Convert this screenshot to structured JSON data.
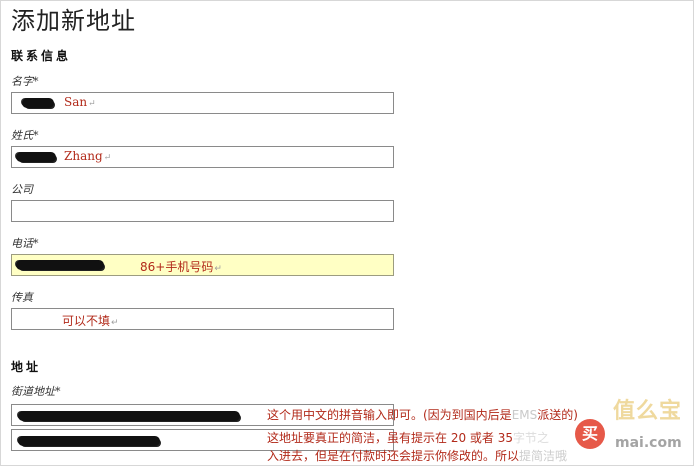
{
  "page": {
    "title": "添加新地址"
  },
  "contact_section": {
    "title": "联系信息",
    "fields": [
      {
        "label": "名字*",
        "note": "San",
        "return_mark": "↵"
      },
      {
        "label": "姓氏*",
        "note": "Zhang",
        "return_mark": "↵"
      },
      {
        "label": "公司",
        "note": ""
      },
      {
        "label": "电话*",
        "note": "86+手机号码",
        "return_mark": "↵"
      },
      {
        "label": "传真",
        "note": "可以不填",
        "return_mark": "↵"
      }
    ]
  },
  "address_section": {
    "title": "地址",
    "street_label": "街道地址*",
    "notes": [
      "这个用中文的拼音输入即可。(因为到国内后是",
      "EMS",
      "派送的)",
      "这地址要真正的简洁，虽有提示在 20 或者 35",
      "入进去，但是在付款时还会提示你修改的。所以"
    ],
    "note_tail_fragments": [
      "字节之",
      "提简洁哦"
    ]
  },
  "watermark": {
    "badge": "买",
    "top_text": "值么宝",
    "bottom_text": "mai.com"
  },
  "colors": {
    "note_red": "#b22a1a",
    "highlight_yellow": "#ffffc4",
    "field_border": "#8a8a8a"
  }
}
